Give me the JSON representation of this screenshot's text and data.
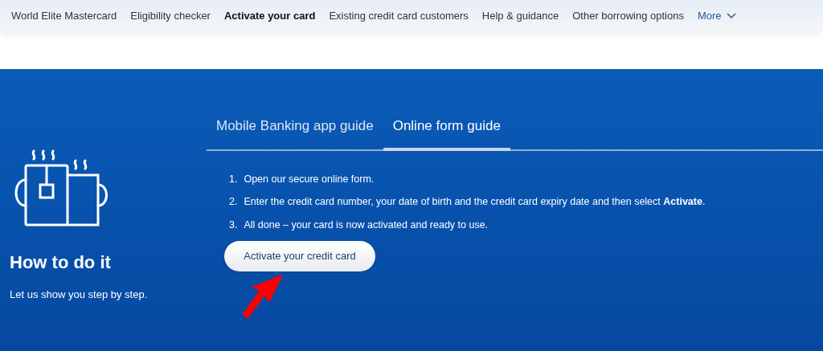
{
  "nav": {
    "items": [
      {
        "label": "World Elite Mastercard",
        "selected": false
      },
      {
        "label": "Eligibility checker",
        "selected": false
      },
      {
        "label": "Activate your card",
        "selected": true
      },
      {
        "label": "Existing credit card customers",
        "selected": false
      },
      {
        "label": "Help & guidance",
        "selected": false
      },
      {
        "label": "Other borrowing options",
        "selected": false
      }
    ],
    "more": "More"
  },
  "intro": {
    "heading": "How to do it",
    "text": "Let us show you step by step."
  },
  "tabs": [
    {
      "label": "Mobile Banking app guide",
      "selected": false
    },
    {
      "label": "Online form guide",
      "selected": true
    }
  ],
  "steps": [
    {
      "number": "1.",
      "text": "Open our secure online form."
    },
    {
      "number": "2.",
      "text": "Enter the credit card number, your date of birth and the credit card expiry date and then select **Activate**."
    },
    {
      "number": "3.",
      "text": "All done – your card is now activated and ready to use."
    }
  ],
  "button": "Activate your credit card"
}
